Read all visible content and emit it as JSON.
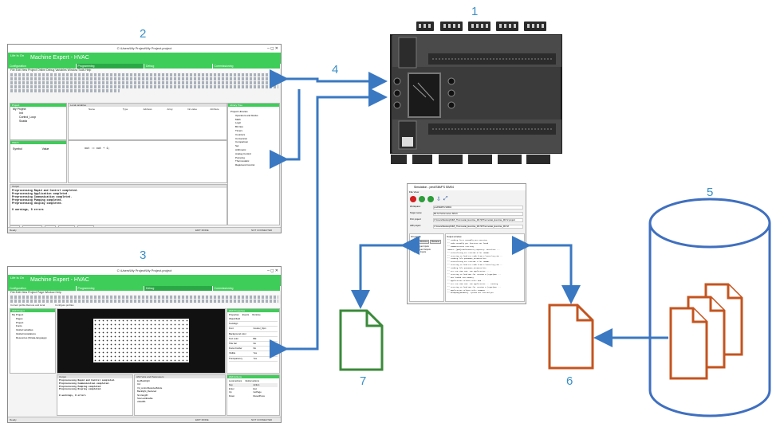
{
  "labels": {
    "n1": "1",
    "n2": "2",
    "n3": "3",
    "n4": "4",
    "n5": "5",
    "n6": "6",
    "n7": "7"
  },
  "colors": {
    "arrow": "#3a78c2",
    "number": "#3a8fc7",
    "green_doc": "#3a8a3a",
    "orange_doc": "#c4541f",
    "cylinder": "#3f6fbf",
    "brand": "#3dcd58"
  },
  "window1": {
    "path": "C:\\Users\\My Project\\My Project.project",
    "app": "Machine Expert - HVAC",
    "brand": "Life Is On",
    "tabs": [
      "Configuration",
      "Programming",
      "Debug",
      "Commissioning"
    ],
    "menu": "File  Edit  View  Project  Online  Debug  Variables  Window  Tools  Help",
    "project_panel": "Project",
    "project_root": "My Project",
    "tree": [
      "Init",
      "Control_Loop",
      "Scada"
    ],
    "local_vars": "Local variables",
    "local_cols": [
      "Name",
      "Type",
      "Address",
      "Array",
      "Init value",
      "Attribute"
    ],
    "library": "Library Tree",
    "library_items": [
      "Project Libraries",
      "Operators and blocks",
      "Math",
      "Logic",
      "Bit Ops",
      "Timers",
      "Counters",
      "Conversion",
      "Comparison",
      "Sel",
      "Arithmetic",
      "Analog Control",
      "Pumping",
      "Thermostatic",
      "Rapid and Control"
    ],
    "watch": "Watch",
    "watch_cols": [
      "Symbol",
      "Value"
    ],
    "code": "out := out + 1;",
    "output_title": "Output",
    "output_lines": [
      "Preprocessing Rapid and Control completed.",
      "Preprocessing Application completed.",
      "Preprocessing Communication completed.",
      "Preprocessing Pumping completed.",
      "Preprocessing display completed.",
      "",
      "0 warnings, 0 errors"
    ],
    "bottom_tabs": [
      "Build",
      "Find in project",
      "Debug",
      "Resources",
      "HMI Output"
    ],
    "mode": "EDIT MODE",
    "conn": "NOT CONNECTED",
    "ready": "Ready"
  },
  "window3": {
    "path": "C:\\Users\\My Project\\My Project.project",
    "app": "Machine Expert - HVAC",
    "brand": "Life Is On",
    "tabs": [
      "Configuration",
      "Programming",
      "Debug",
      "Commissioning"
    ],
    "menu": "File  Edit  View  Project  Page  Window  Help",
    "toolbar": "Current profile  Remote and local",
    "configure": "Configure profiles",
    "hmi_project": "HMI Project",
    "tree": [
      "My Project",
      "Pages",
      "Project",
      "Fonts",
      "Global variables",
      "Global translations",
      "Resources (Strata-language)"
    ],
    "props_title": "HMI Properties",
    "props_tabs": [
      "Properties",
      "Events",
      "Runtime"
    ],
    "props": [
      [
        "Object/field",
        ""
      ],
      [
        "TextAlign",
        ""
      ],
      [
        "Font",
        "Courier_6pm"
      ],
      [
        "Background color",
        ""
      ],
      [
        "Text color",
        "Blk"
      ],
      [
        "Title bar",
        "No"
      ],
      [
        "Focus border",
        "No"
      ],
      [
        "Visible",
        "Yes"
      ],
      [
        "Transparency",
        "Yes"
      ]
    ],
    "output_title": "Output",
    "output_lines": [
      "Preprocessing Rapid and Control completed.",
      "Preprocessing Communication completed.",
      "Preprocessing Pumping completed.",
      "Preprocessing Display completed.",
      "",
      "0 warnings, 0 errors"
    ],
    "vars_title": "HMI Vars and Parameters",
    "vars": [
      "keyBacklight",
      "Init:",
      "Vd_controlSelectedMode",
      "Backlight_Reduced",
      "hmi.langID",
      "Scan.actEnable",
      "valueBA"
    ],
    "actions": "HMI Actions",
    "actions_tabs": [
      "Local actions",
      "Global actions"
    ],
    "actions_cols": [
      "Key",
      "Action"
    ],
    "actions_rows": [
      [
        "Enter",
        "Esc"
      ],
      [
        "Up",
        "GoPage"
      ],
      [
        "Down",
        "ResetPress"
      ]
    ],
    "bottom_tabs": [
      "Build",
      "Find in project",
      "Debug",
      "Resources",
      "HMI Output"
    ],
    "lower_tabs": [
      "Object view",
      "Local Parameters"
    ],
    "mode": "EDIT MODE",
    "conn": "NOT CONNECTED",
    "ready": "Ready"
  },
  "simulator": {
    "title": "Simulation - pmd/SIM/FS SIM04",
    "menu": "File  View",
    "fields": [
      [
        "Workspace:",
        "pmdSIM/FS SIM04"
      ],
      [
        "Target name:",
        "M172 Performance SIM-6"
      ],
      [
        "PLC project:",
        "C:\\Users\\Desktop\\SIM\\_Thermostat_Exercise_M172\\Thermostat_Exercise_M172.project"
      ],
      [
        "HMI project:",
        "C:\\Users\\Desktop\\SIM\\_Thermostat_Exercise_M172\\Thermostat_Exercise_M172\\"
      ]
    ],
    "io_title": "I/O panels",
    "io_buttons": [
      "Add",
      "Remove",
      "Rename"
    ],
    "io_items": [
      "Analogue Inputs",
      "Analogue Outputs",
      "Digital Inputs"
    ],
    "out_title": "Output window",
    "out_lines": [
      "** Loading first Assembly per Function",
      "** Code assembly per function not found",
      "** Communication starting",
      "SEM011: [pmd]SimThermostat,Capacity: Interface ...",
      "** Initializing PLC runtime 0 for TARGET",
      "** Starting to load PLC code from C:\\Users\\Sp_Sim ...",
      "** Loading file pcmSEM01_Firmware.bin",
      "** Initializing PLC runtime 1 for TARGET",
      "** Starting to load PLC code from C:\\Users\\Sp_Sim ...",
      "** Loading file pcmSEM01_Firmware.bin",
      "** PLC run-time VOO: 1VE application .....",
      "** Starting to load HMI for runtime 0 (type)HMI ...",
      "** HMI loaded into memory",
      "** Application release info: ENG ...",
      "** PLC run-time VOO: 1VE application ... running",
      "** Starting to load HMI for runtime 0 (type)HMI ...",
      "** Application release info: PMDBRIT ...",
      "** ReadyHwp[HmiBoot]. System not started yet"
    ]
  }
}
